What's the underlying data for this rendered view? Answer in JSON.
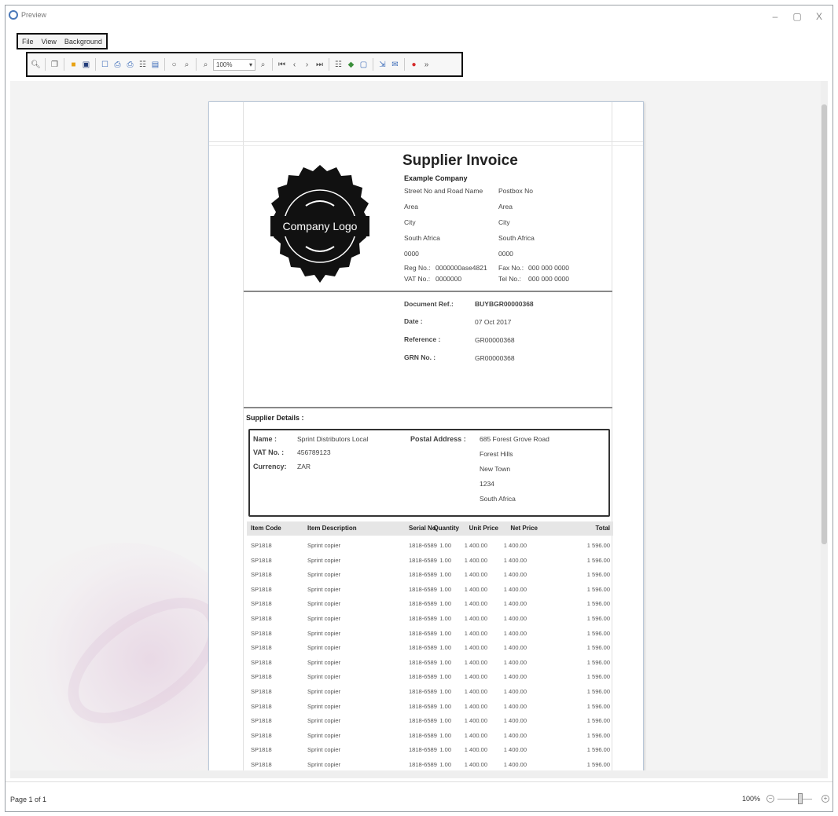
{
  "window": {
    "title": "Preview",
    "min": "–",
    "max": "▢",
    "close": "X"
  },
  "menu": [
    "File",
    "View",
    "Background"
  ],
  "toolbar": {
    "zoom_value": "100%",
    "icons": [
      "search-icon",
      "copy-icon",
      "open-folder-icon",
      "save-icon",
      "page-setup-icon",
      "print-icon",
      "quick-print-icon",
      "margins-icon",
      "header-footer-icon",
      "hand-tool-icon",
      "magnifier-icon",
      "zoom-out-icon",
      "zoom-in-icon",
      "first-page-icon",
      "previous-page-icon",
      "next-page-icon",
      "last-page-icon",
      "multiple-pages-icon",
      "color-icon",
      "watermark-icon",
      "export-icon",
      "send-email-icon",
      "close-preview-icon"
    ]
  },
  "invoice": {
    "title": "Supplier Invoice",
    "logo_text": "Company Logo",
    "company": "Example Company",
    "address_left": [
      "Street No and Road Name",
      "Area",
      "City",
      "South Africa",
      "0000"
    ],
    "address_right": [
      "Postbox No",
      "Area",
      "City",
      "South Africa",
      "0000"
    ],
    "reg_label": "Reg No.:",
    "reg_value": "0000000ase4821",
    "fax_label": "Fax No.:",
    "fax_value": "000 000 0000",
    "vat_label": "VAT No.:",
    "vat_value": "0000000",
    "tel_label": "Tel No.:",
    "tel_value": "000 000 0000",
    "doc_ref_label": "Document Ref.:",
    "doc_ref_value": "BUYBGR00000368",
    "date_label": "Date :",
    "date_value": "07 Oct 2017",
    "reference_label": "Reference :",
    "reference_value": "GR00000368",
    "grn_label": "GRN No. :",
    "grn_value": "GR00000368",
    "supplier_heading": "Supplier Details :",
    "supplier": {
      "name_label": "Name :",
      "name_value": "Sprint Distributors Local",
      "vat_label": "VAT No. :",
      "vat_value": "456789123",
      "currency_label": "Currency:",
      "currency_value": "ZAR",
      "postal_label": "Postal Address :",
      "postal_lines": [
        "685 Forest Grove Road",
        "Forest Hills",
        "New Town",
        "1234",
        "South Africa"
      ]
    },
    "columns": [
      "Item Code",
      "Item Description",
      "Serial No.",
      "Quantity",
      "Unit Price",
      "Net Price",
      "Total"
    ],
    "rows": [
      [
        "SP1818",
        "Sprint copier",
        "1818-6589",
        "1.00",
        "1 400.00",
        "1 400.00",
        "1 596.00"
      ],
      [
        "SP1818",
        "Sprint copier",
        "1818-6589",
        "1.00",
        "1 400.00",
        "1 400.00",
        "1 596.00"
      ],
      [
        "SP1818",
        "Sprint copier",
        "1818-6589",
        "1.00",
        "1 400.00",
        "1 400.00",
        "1 596.00"
      ],
      [
        "SP1818",
        "Sprint copier",
        "1818-6589",
        "1.00",
        "1 400.00",
        "1 400.00",
        "1 596.00"
      ],
      [
        "SP1818",
        "Sprint copier",
        "1818-6589",
        "1.00",
        "1 400.00",
        "1 400.00",
        "1 596.00"
      ],
      [
        "SP1818",
        "Sprint copier",
        "1818-6589",
        "1.00",
        "1 400.00",
        "1 400.00",
        "1 596.00"
      ],
      [
        "SP1818",
        "Sprint copier",
        "1818-6589",
        "1.00",
        "1 400.00",
        "1 400.00",
        "1 596.00"
      ],
      [
        "SP1818",
        "Sprint copier",
        "1818-6589",
        "1.00",
        "1 400.00",
        "1 400.00",
        "1 596.00"
      ],
      [
        "SP1818",
        "Sprint copier",
        "1818-6589",
        "1.00",
        "1 400.00",
        "1 400.00",
        "1 596.00"
      ],
      [
        "SP1818",
        "Sprint copier",
        "1818-6589",
        "1.00",
        "1 400.00",
        "1 400.00",
        "1 596.00"
      ],
      [
        "SP1818",
        "Sprint copier",
        "1818-6589",
        "1.00",
        "1 400.00",
        "1 400.00",
        "1 596.00"
      ],
      [
        "SP1818",
        "Sprint copier",
        "1818-6589",
        "1.00",
        "1 400.00",
        "1 400.00",
        "1 596.00"
      ],
      [
        "SP1818",
        "Sprint copier",
        "1818-6589",
        "1.00",
        "1 400.00",
        "1 400.00",
        "1 596.00"
      ],
      [
        "SP1818",
        "Sprint copier",
        "1818-6589",
        "1.00",
        "1 400.00",
        "1 400.00",
        "1 596.00"
      ],
      [
        "SP1818",
        "Sprint copier",
        "1818-6589",
        "1.00",
        "1 400.00",
        "1 400.00",
        "1 596.00"
      ],
      [
        "SP1818",
        "Sprint copier",
        "1818-6589",
        "1.00",
        "1 400.00",
        "1 400.00",
        "1 596.00"
      ]
    ]
  },
  "status": {
    "page": "Page 1 of 1",
    "zoom": "100%",
    "zoom_minus": "−",
    "zoom_plus": "+"
  }
}
